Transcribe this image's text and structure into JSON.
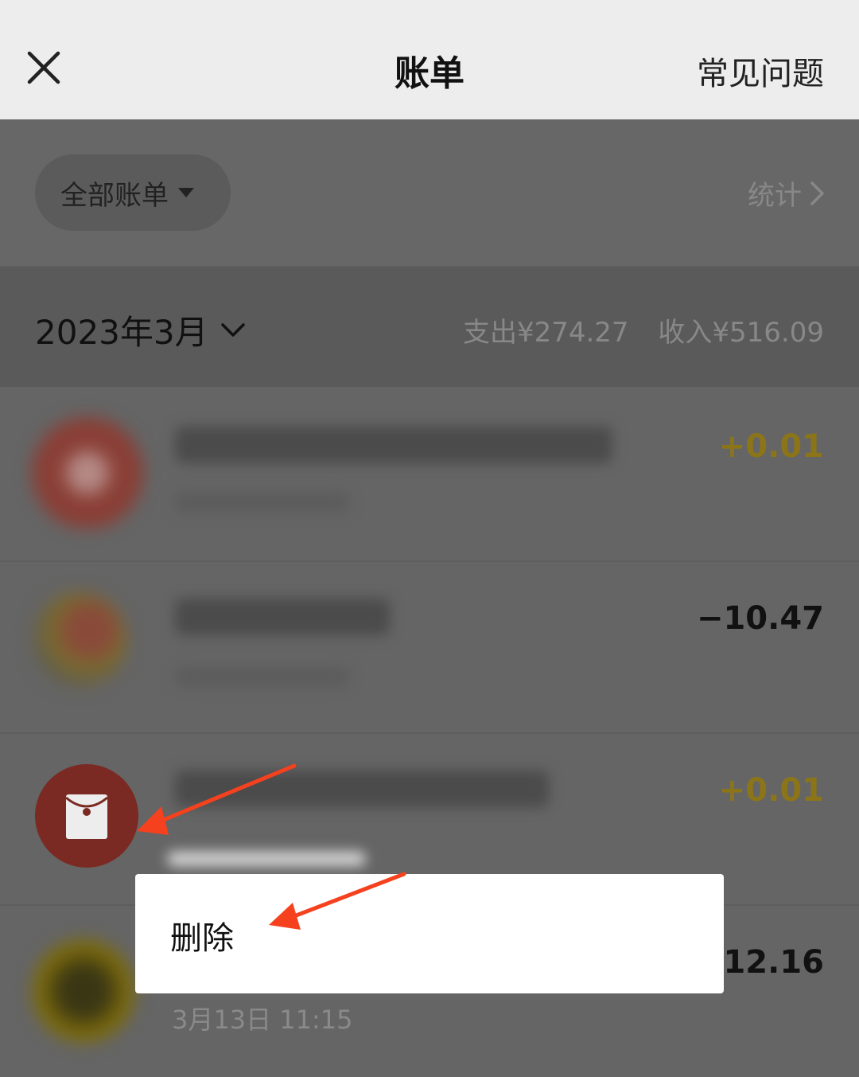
{
  "nav": {
    "title": "账单",
    "faq_label": "常见问题"
  },
  "filter": {
    "label": "全部账单",
    "stats_label": "统计"
  },
  "month": {
    "label": "2023年3月",
    "expense": "支出¥274.27",
    "income": "收入¥516.09"
  },
  "transactions": [
    {
      "amount": "+0.01"
    },
    {
      "amount": "−10.47"
    },
    {
      "amount": "+0.01"
    },
    {
      "amount": "−12.16",
      "time": "3月13日 11:15"
    }
  ],
  "context_menu": {
    "delete_label": "删除"
  },
  "colors": {
    "income": "#8c7519",
    "annotation_arrow": "#f5411e",
    "red_packet": "#7a2a22"
  },
  "icons": {
    "close": "close-icon",
    "chevron": "chevron-right-icon",
    "dropdown": "chevron-down-icon",
    "red_packet": "red-packet-icon"
  }
}
